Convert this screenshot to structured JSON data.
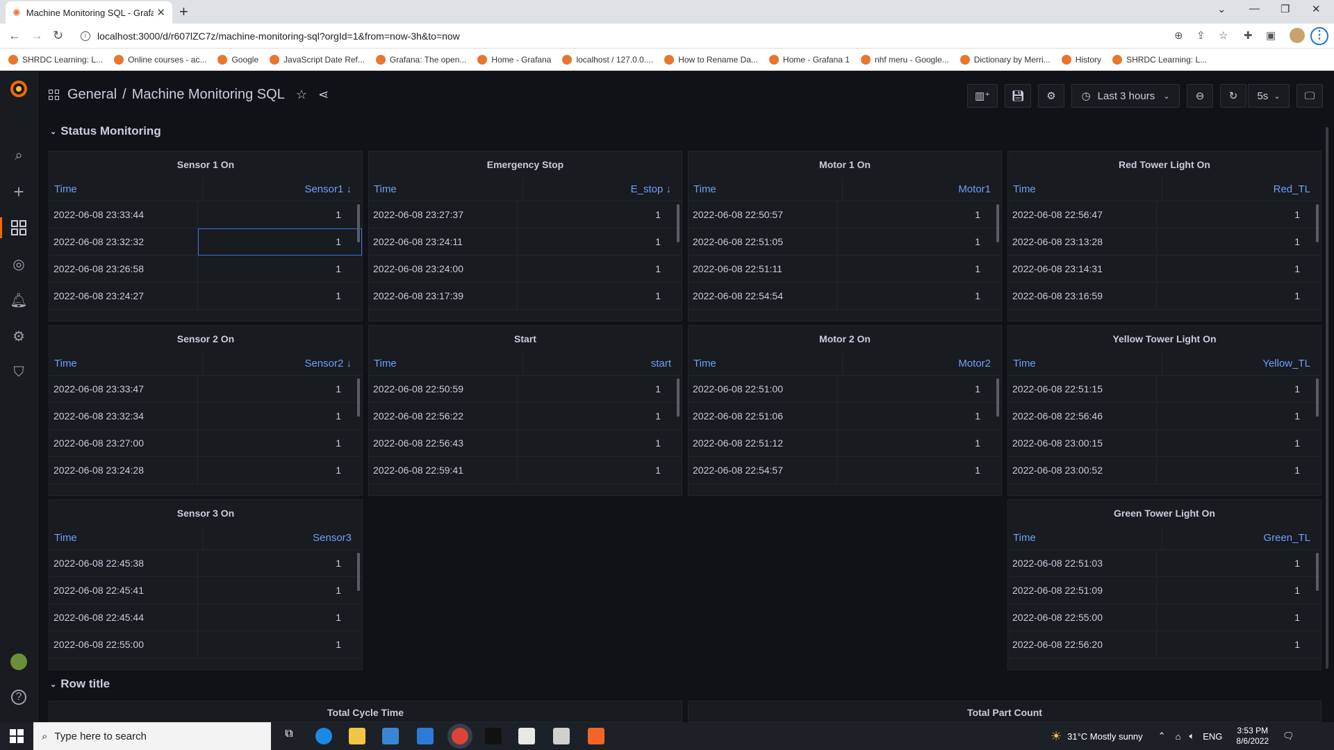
{
  "browser": {
    "tab_title": "Machine Monitoring SQL - Grafana",
    "url": "localhost:3000/d/r607lZC7z/machine-monitoring-sql?orgId=1&from=now-3h&to=now",
    "bookmarks": [
      "SHRDC Learning: L...",
      "Online courses - ac...",
      "Google",
      "JavaScript Date Ref...",
      "Grafana: The open...",
      "Home - Grafana",
      "localhost / 127.0.0....",
      "How to Rename Da...",
      "Home - Grafana 1",
      "nhf meru - Google...",
      "Dictionary by Merri...",
      "History",
      "SHRDC Learning: L..."
    ]
  },
  "header": {
    "folder": "General",
    "separator": "/",
    "dashboard_title": "Machine Monitoring SQL",
    "time_range": "Last 3 hours",
    "refresh": "5s"
  },
  "rows": [
    {
      "title": "Status Monitoring"
    },
    {
      "title": "Row title"
    }
  ],
  "panels": [
    {
      "title": "Sensor 1 On",
      "col_time": "Time",
      "col_value": "Sensor1 ↓",
      "rows": [
        [
          "2022-06-08 23:33:44",
          "1"
        ],
        [
          "2022-06-08 23:32:32",
          "1"
        ],
        [
          "2022-06-08 23:26:58",
          "1"
        ],
        [
          "2022-06-08 23:24:27",
          "1"
        ]
      ]
    },
    {
      "title": "Emergency Stop",
      "col_time": "Time",
      "col_value": "E_stop ↓",
      "rows": [
        [
          "2022-06-08 23:27:37",
          "1"
        ],
        [
          "2022-06-08 23:24:11",
          "1"
        ],
        [
          "2022-06-08 23:24:00",
          "1"
        ],
        [
          "2022-06-08 23:17:39",
          "1"
        ]
      ]
    },
    {
      "title": "Motor 1 On",
      "col_time": "Time",
      "col_value": "Motor1",
      "rows": [
        [
          "2022-06-08 22:50:57",
          "1"
        ],
        [
          "2022-06-08 22:51:05",
          "1"
        ],
        [
          "2022-06-08 22:51:11",
          "1"
        ],
        [
          "2022-06-08 22:54:54",
          "1"
        ]
      ]
    },
    {
      "title": "Red Tower Light On",
      "col_time": "Time",
      "col_value": "Red_TL",
      "rows": [
        [
          "2022-06-08 22:56:47",
          "1"
        ],
        [
          "2022-06-08 23:13:28",
          "1"
        ],
        [
          "2022-06-08 23:14:31",
          "1"
        ],
        [
          "2022-06-08 23:16:59",
          "1"
        ]
      ]
    },
    {
      "title": "Sensor 2 On",
      "col_time": "Time",
      "col_value": "Sensor2 ↓",
      "rows": [
        [
          "2022-06-08 23:33:47",
          "1"
        ],
        [
          "2022-06-08 23:32:34",
          "1"
        ],
        [
          "2022-06-08 23:27:00",
          "1"
        ],
        [
          "2022-06-08 23:24:28",
          "1"
        ]
      ]
    },
    {
      "title": "Start",
      "col_time": "Time",
      "col_value": "start",
      "rows": [
        [
          "2022-06-08 22:50:59",
          "1"
        ],
        [
          "2022-06-08 22:56:22",
          "1"
        ],
        [
          "2022-06-08 22:56:43",
          "1"
        ],
        [
          "2022-06-08 22:59:41",
          "1"
        ]
      ]
    },
    {
      "title": "Motor 2 On",
      "col_time": "Time",
      "col_value": "Motor2",
      "rows": [
        [
          "2022-06-08 22:51:00",
          "1"
        ],
        [
          "2022-06-08 22:51:06",
          "1"
        ],
        [
          "2022-06-08 22:51:12",
          "1"
        ],
        [
          "2022-06-08 22:54:57",
          "1"
        ]
      ]
    },
    {
      "title": "Yellow Tower Light On",
      "col_time": "Time",
      "col_value": "Yellow_TL",
      "rows": [
        [
          "2022-06-08 22:51:15",
          "1"
        ],
        [
          "2022-06-08 22:56:46",
          "1"
        ],
        [
          "2022-06-08 23:00:15",
          "1"
        ],
        [
          "2022-06-08 23:00:52",
          "1"
        ]
      ]
    },
    {
      "title": "Sensor 3 On",
      "col_time": "Time",
      "col_value": "Sensor3",
      "rows": [
        [
          "2022-06-08 22:45:38",
          "1"
        ],
        [
          "2022-06-08 22:45:41",
          "1"
        ],
        [
          "2022-06-08 22:45:44",
          "1"
        ],
        [
          "2022-06-08 22:55:00",
          "1"
        ]
      ]
    },
    {
      "title": "Green Tower Light On",
      "col_time": "Time",
      "col_value": "Green_TL",
      "rows": [
        [
          "2022-06-08 22:51:03",
          "1"
        ],
        [
          "2022-06-08 22:51:09",
          "1"
        ],
        [
          "2022-06-08 22:55:00",
          "1"
        ],
        [
          "2022-06-08 22:56:20",
          "1"
        ]
      ]
    }
  ],
  "bottom_panels": [
    {
      "title": "Total Cycle Time"
    },
    {
      "title": "Total Part Count"
    }
  ],
  "taskbar": {
    "search_placeholder": "Type here to search",
    "weather": "31°C  Mostly sunny",
    "lang": "ENG",
    "time": "3:53 PM",
    "date": "8/6/2022"
  }
}
